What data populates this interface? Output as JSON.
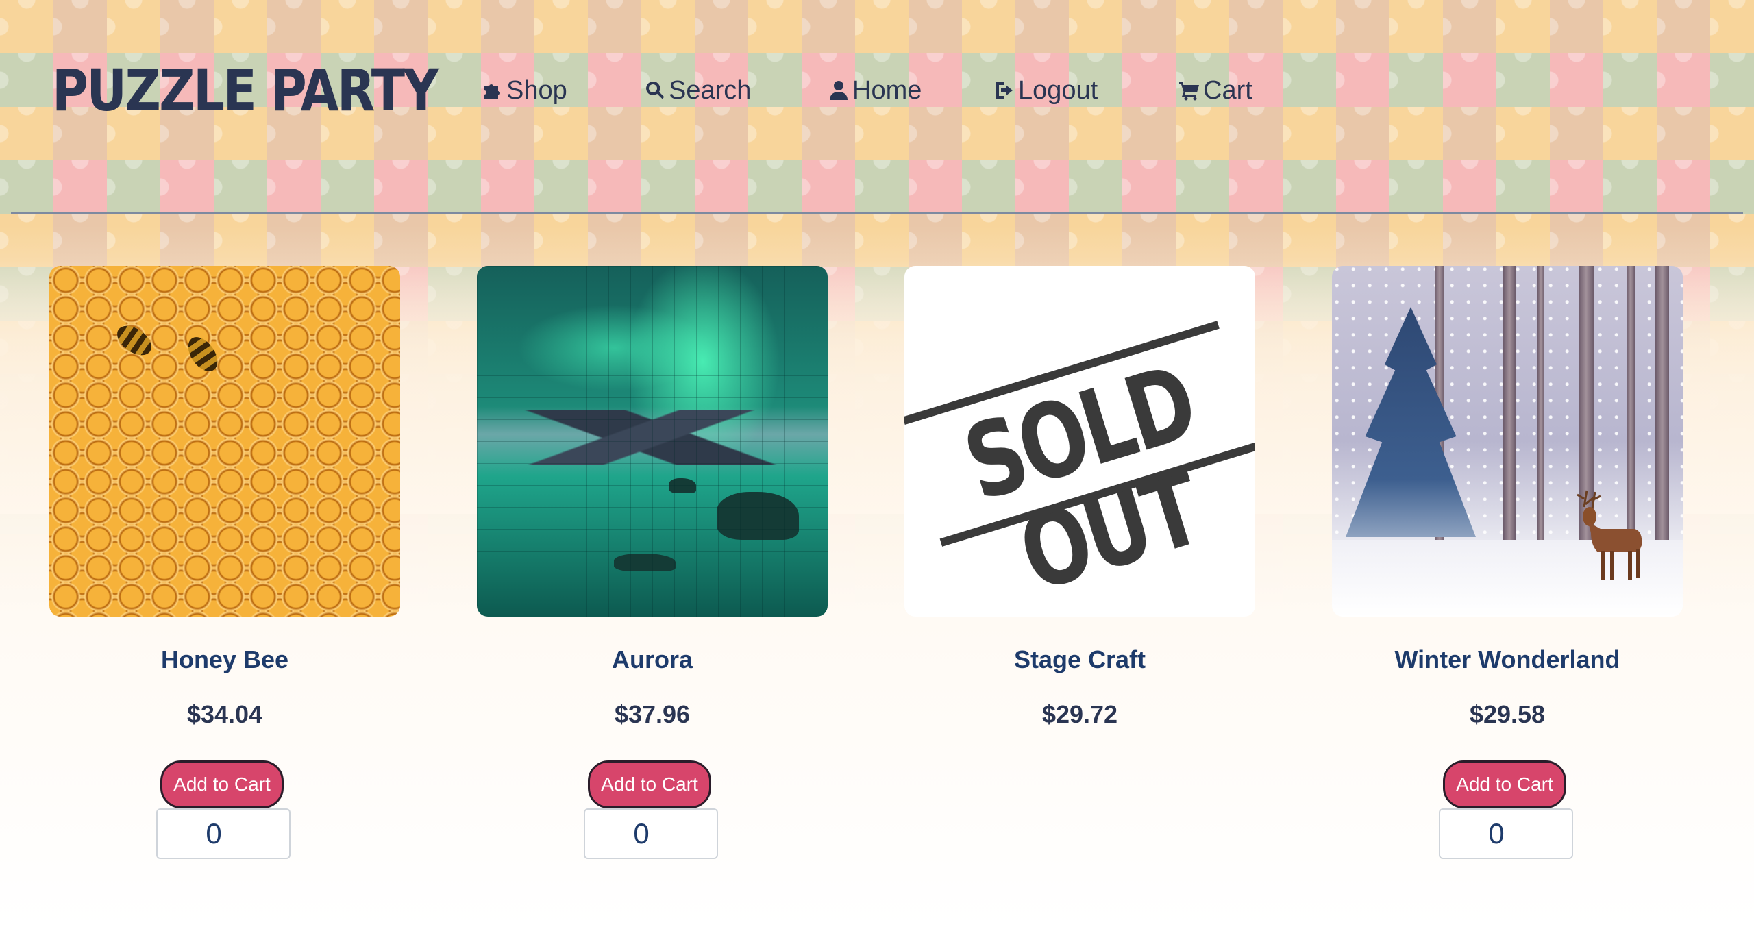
{
  "header": {
    "logo": "PUZZLE PARTY",
    "nav": [
      {
        "label": "Shop",
        "icon": "puzzle-icon"
      },
      {
        "label": "Search",
        "icon": "search-icon"
      },
      {
        "label": "Home",
        "icon": "user-icon"
      },
      {
        "label": "Logout",
        "icon": "logout-icon"
      },
      {
        "label": "Cart",
        "icon": "cart-icon"
      }
    ]
  },
  "products": [
    {
      "name": "Honey Bee",
      "price": "$34.04",
      "button": "Add to Cart",
      "quantity": "0",
      "image": "honeycomb-bees",
      "sold_out": false
    },
    {
      "name": "Aurora",
      "price": "$37.96",
      "button": "Add to Cart",
      "quantity": "0",
      "image": "aurora-puzzle",
      "sold_out": false
    },
    {
      "name": "Stage Craft",
      "price": "$29.72",
      "image": "sold-out-stamp",
      "stamp_text": "SOLD OUT",
      "sold_out": true
    },
    {
      "name": "Winter Wonderland",
      "price": "$29.58",
      "button": "Add to Cart",
      "quantity": "0",
      "image": "winter-deer-forest",
      "sold_out": false
    }
  ],
  "colors": {
    "text_dark": "#2a3552",
    "product_name": "#1e3b6b",
    "button": "#d7456b"
  }
}
